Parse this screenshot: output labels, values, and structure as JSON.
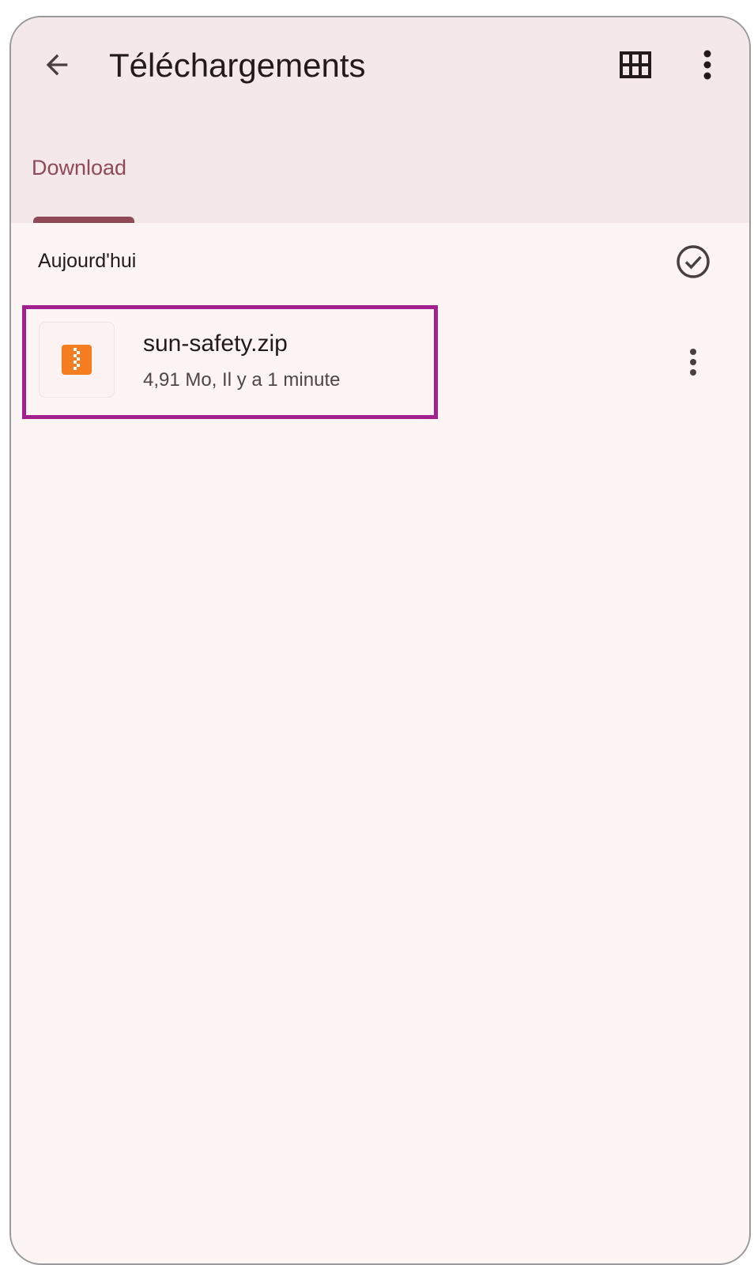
{
  "appbar": {
    "title": "Téléchargements",
    "back_icon": "arrow-back-icon",
    "grid_icon": "grid-view-icon",
    "more_icon": "more-vert-icon",
    "background": "#f4e8e8"
  },
  "tabs": [
    {
      "label": "Download",
      "selected": true,
      "accent": "#8f4a57"
    }
  ],
  "sections": [
    {
      "header": "Aujourd'hui",
      "select_icon": "check-circle-icon",
      "items": [
        {
          "name": "sun-safety.zip",
          "meta": "4,91 Mo, Il y a 1 minute",
          "file_icon": "zip-file-icon",
          "icon_color": "#f57c1f",
          "more_icon": "more-vert-icon",
          "highlight_color": "#a1218e"
        }
      ]
    }
  ]
}
